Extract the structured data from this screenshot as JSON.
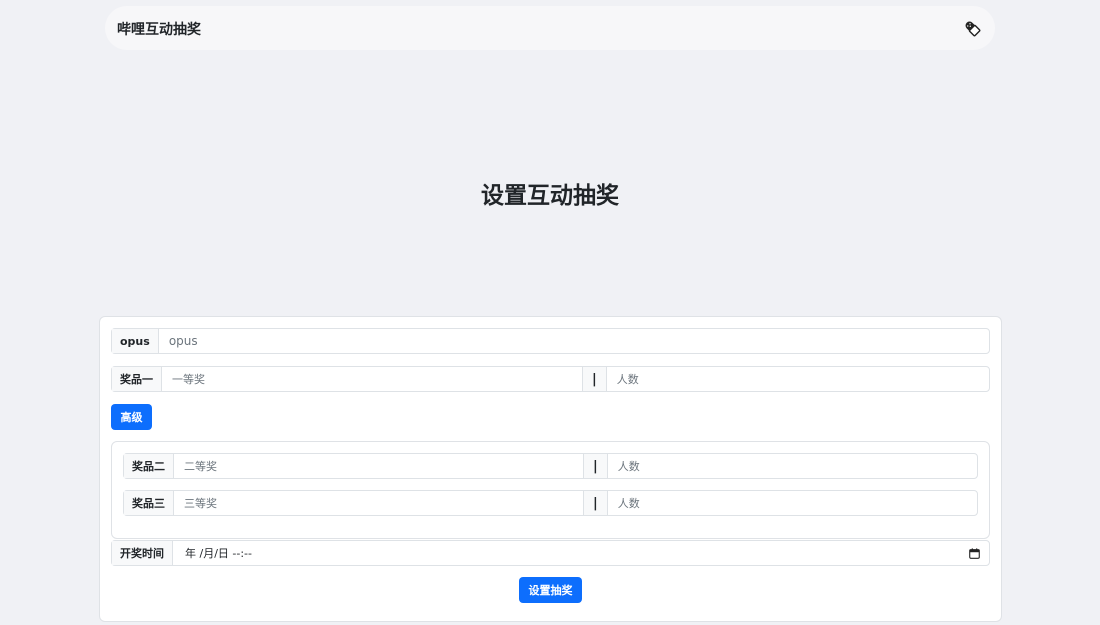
{
  "nav": {
    "brand": "哔哩互动抽奖",
    "theme_icon": "theme-toggle-icon"
  },
  "title": "设置互动抽奖",
  "form": {
    "opus": {
      "label": "opus",
      "placeholder": "opus"
    },
    "prize1": {
      "label": "奖品一",
      "name_placeholder": "一等奖",
      "separator": "|",
      "count_placeholder": "人数"
    },
    "advanced_button": "高级",
    "prize2": {
      "label": "奖品二",
      "name_placeholder": "二等奖",
      "separator": "|",
      "count_placeholder": "人数"
    },
    "prize3": {
      "label": "奖品三",
      "name_placeholder": "三等奖",
      "separator": "|",
      "count_placeholder": "人数"
    },
    "draw_time": {
      "label": "开奖时间",
      "value_display": "年 /月/日 --:--",
      "icon": "calendar-icon"
    },
    "submit_button": "设置抽奖"
  },
  "colors": {
    "primary": "#0d6efd",
    "page_bg": "#f0f1f5",
    "card_bg": "#ffffff"
  }
}
